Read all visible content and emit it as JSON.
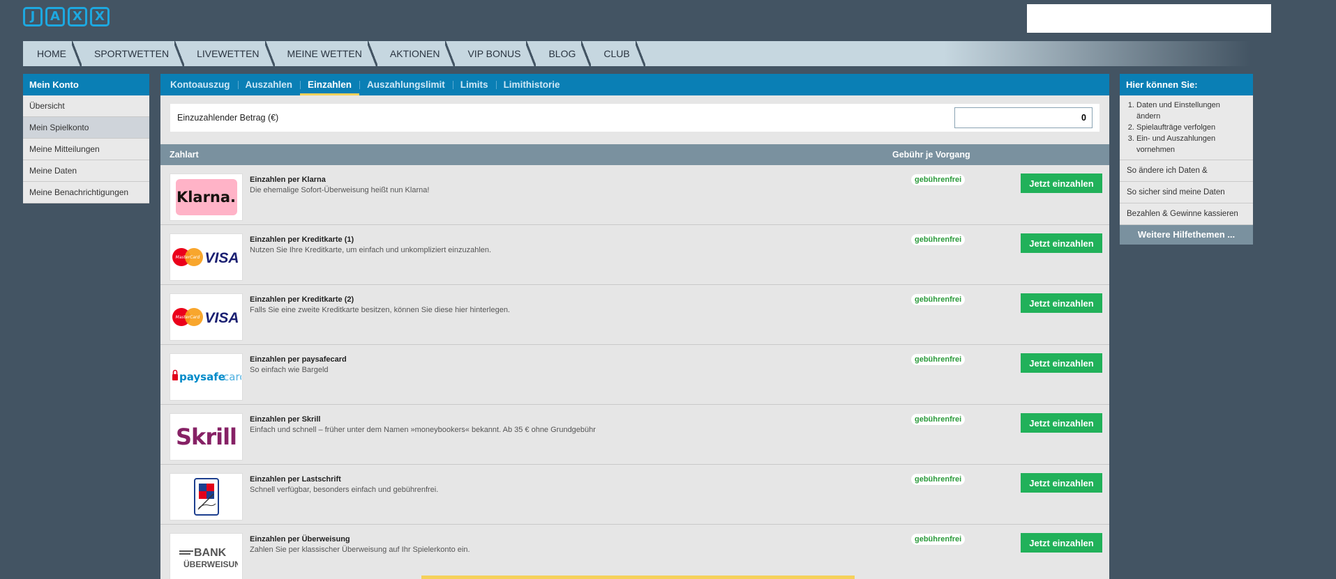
{
  "header": {
    "logo_letters": [
      "J",
      "A",
      "X",
      "X"
    ],
    "brand_color": "#1da8e0"
  },
  "mainnav": [
    "HOME",
    "SPORTWETTEN",
    "LIVEWETTEN",
    "MEINE WETTEN",
    "AKTIONEN",
    "VIP BONUS",
    "BLOG",
    "CLUB"
  ],
  "left": {
    "title": "Mein Konto",
    "items": [
      "Übersicht",
      "Mein Spielkonto",
      "Meine Mitteilungen",
      "Meine Daten",
      "Meine Benachrichtigungen"
    ],
    "active_index": 1
  },
  "subtabs": {
    "items": [
      "Kontoauszug",
      "Auszahlen",
      "Einzahlen",
      "Auszahlungslimit",
      "Limits",
      "Limithistorie"
    ],
    "active_index": 2
  },
  "amount": {
    "label": "Einzuzahlender Betrag (€)",
    "value": "0"
  },
  "table": {
    "col_method": "Zahlart",
    "col_fee": "Gebühr je Vorgang",
    "rows": [
      {
        "logo": "Klarna.",
        "title": "Einzahlen per Klarna",
        "desc": "Die ehemalige Sofort-Überweisung heißt nun Klarna!",
        "fee": "gebührenfrei",
        "button": "Jetzt einzahlen"
      },
      {
        "logo": "MasterCard VISA",
        "title": "Einzahlen per Kreditkarte (1)",
        "desc": "Nutzen Sie Ihre Kreditkarte, um einfach und unkompliziert einzuzahlen.",
        "fee": "gebührenfrei",
        "button": "Jetzt einzahlen"
      },
      {
        "logo": "MasterCard VISA",
        "title": "Einzahlen per Kreditkarte (2)",
        "desc": "Falls Sie eine zweite Kreditkarte besitzen, können Sie diese hier hinterlegen.",
        "fee": "gebührenfrei",
        "button": "Jetzt einzahlen"
      },
      {
        "logo": "paysafecard",
        "title": "Einzahlen per paysafecard",
        "desc": "So einfach wie Bargeld",
        "fee": "gebührenfrei",
        "button": "Jetzt einzahlen"
      },
      {
        "logo": "Skrill",
        "title": "Einzahlen per Skrill",
        "desc": "Einfach und schnell – früher unter dem Namen »moneybookers« bekannt. Ab 35 € ohne Grundgebühr",
        "fee": "gebührenfrei",
        "button": "Jetzt einzahlen"
      },
      {
        "logo": "Lastschrift",
        "title": "Einzahlen per Lastschrift",
        "desc": "Schnell verfügbar, besonders einfach und gebührenfrei.",
        "fee": "gebührenfrei",
        "button": "Jetzt einzahlen"
      },
      {
        "logo": "BANK ÜBERWEISUNG",
        "title": "Einzahlen per Überweisung",
        "desc": "Zahlen Sie per klassischer Überweisung auf Ihr Spielerkonto ein.",
        "fee": "gebührenfrei",
        "button": "Jetzt einzahlen"
      }
    ]
  },
  "right": {
    "title": "Hier können Sie:",
    "list": [
      "Daten und Einstellungen ändern",
      "Spielaufträge verfolgen",
      "Ein- und Auszahlungen vornehmen"
    ],
    "links": [
      "So ändere ich Daten &",
      "So sicher sind meine Daten",
      "Bezahlen & Gewinne kassieren"
    ],
    "more": "Weitere Hilfethemen ..."
  },
  "colors": {
    "background": "#435463",
    "accent_blue": "#0a7fb5",
    "button_green": "#21b15a",
    "fee_green": "#2a9a3a",
    "active_tab_underline": "#f5d15a"
  }
}
